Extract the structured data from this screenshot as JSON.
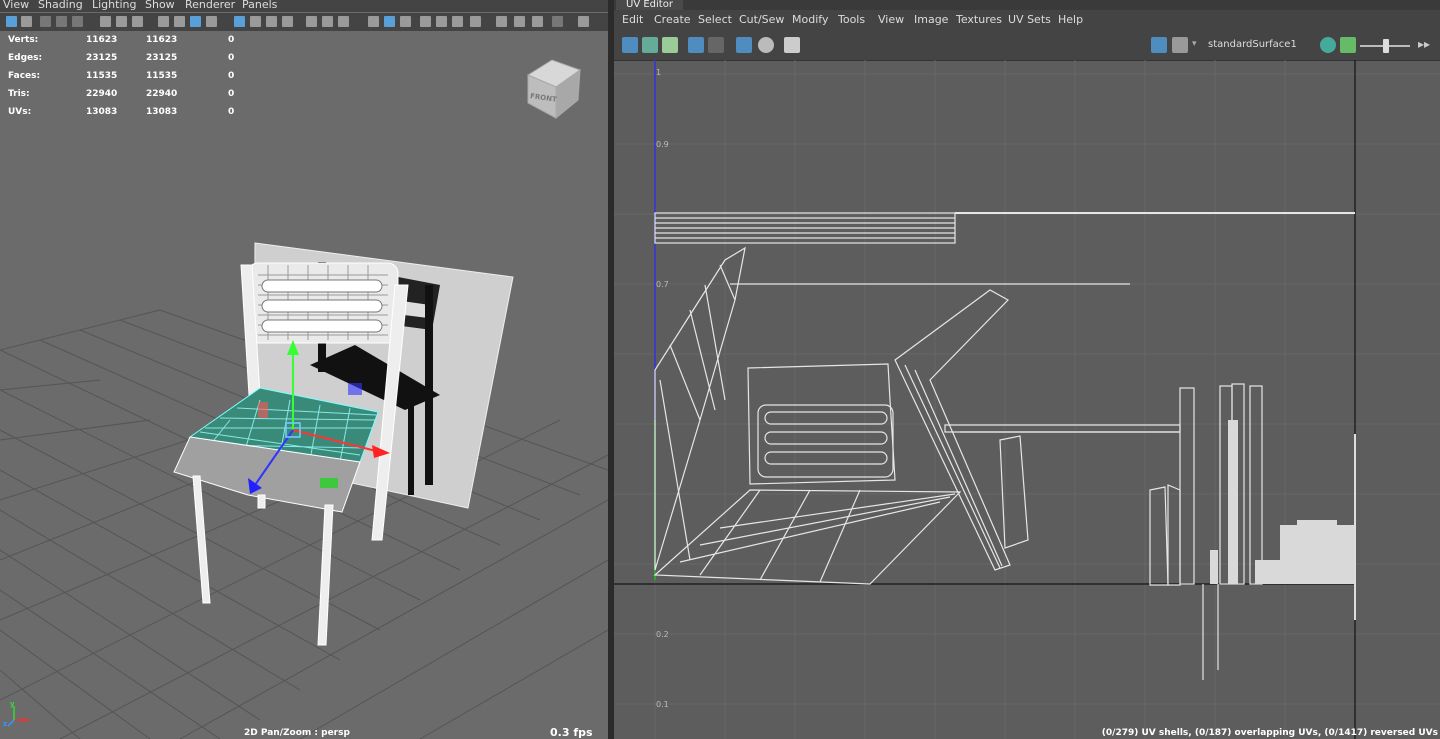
{
  "viewport": {
    "menu": [
      "View",
      "Shading",
      "Lighting",
      "Show",
      "Renderer",
      "Panels"
    ],
    "hud": [
      {
        "label": "Verts:",
        "a": "11623",
        "b": "11623",
        "c": "0"
      },
      {
        "label": "Edges:",
        "a": "23125",
        "b": "23125",
        "c": "0"
      },
      {
        "label": "Faces:",
        "a": "11535",
        "b": "11535",
        "c": "0"
      },
      {
        "label": "Tris:",
        "a": "22940",
        "b": "22940",
        "c": "0"
      },
      {
        "label": "UVs:",
        "a": "13083",
        "b": "13083",
        "c": "0"
      }
    ],
    "viewcube_label": "FRONT",
    "camera_label": "2D Pan/Zoom : persp",
    "fps": "0.3 fps",
    "axis_x": "x",
    "axis_y": "y",
    "axis_z": "z"
  },
  "uv_editor": {
    "tab": "UV Editor",
    "menu": [
      "Edit",
      "Create",
      "Select",
      "Cut/Sew",
      "Modify",
      "Tools",
      "View",
      "Image",
      "Textures",
      "UV Sets",
      "Help"
    ],
    "material": "standardSurface1",
    "grid_labels": [
      "1",
      "0.9",
      "0.7",
      "0.2",
      "0.1"
    ],
    "status": "(0/279) UV shells, (0/187) overlapping UVs, (0/1417) reversed UVs"
  }
}
